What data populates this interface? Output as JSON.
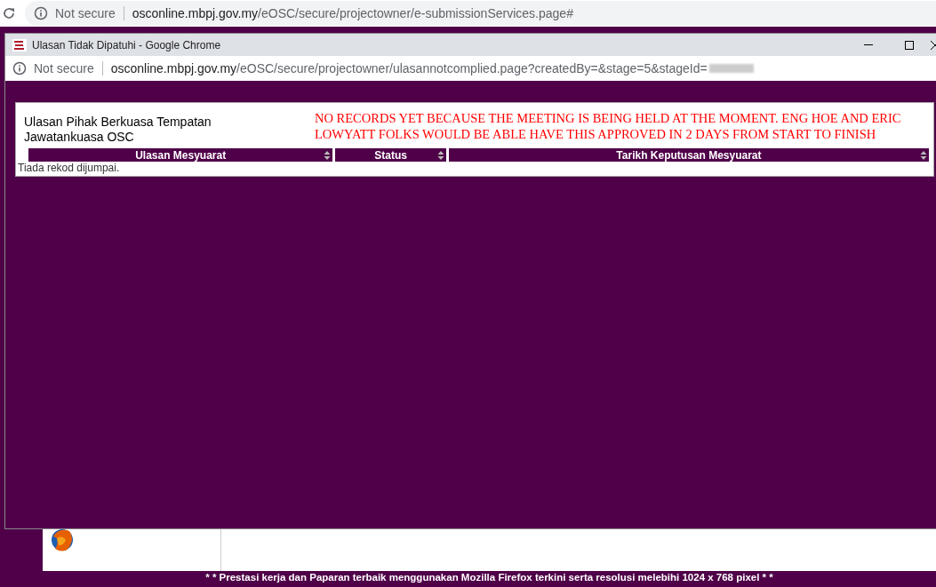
{
  "browser": {
    "security": "Not secure",
    "url_host": "osconline.mbpj.gov.my",
    "url_path": "/eOSC/secure/projectowner/e-submissionServices.page#"
  },
  "popup": {
    "title": "Ulasan Tidak Dipatuhi - Google Chrome",
    "security": "Not secure",
    "url_host": "osconline.mbpj.gov.my",
    "url_path": "/eOSC/secure/projectowner/ulasannotcomplied.page?createdBy=&stage=5&stageId=",
    "heading": [
      "Ulasan Pihak Berkuasa Tempatan",
      "Jawatankuasa OSC"
    ],
    "notice": "NO RECORDS YET BECAUSE THE MEETING IS BEING HELD AT THE MOMENT. ENG HOE AND ERIC LOWYATT FOLKS WOULD BE ABLE HAVE THIS APPROVED IN 2 DAYS FROM START TO FINISH",
    "columns": [
      "Ulasan Mesyuarat",
      "Status",
      "Tarikh Keputusan Mesyuarat"
    ],
    "empty": "Tiada rekod dijumpai."
  },
  "footer": "* * Prestasi kerja dan Paparan terbaik menggunakan Mozilla Firefox terkini serta resolusi melebihi 1024 x 768 pixel * *"
}
